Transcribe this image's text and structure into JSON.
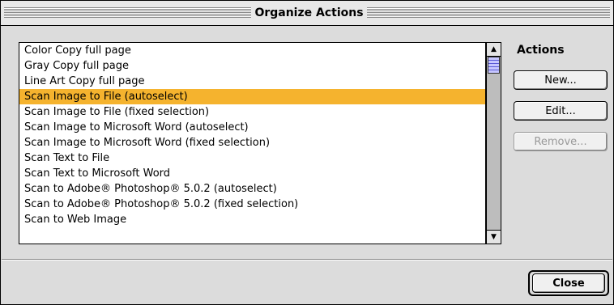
{
  "window": {
    "title": "Organize Actions"
  },
  "list": {
    "items": [
      "Color Copy full page",
      "Gray Copy full page",
      "Line Art Copy full page",
      "Scan Image to File (autoselect)",
      "Scan Image to File (fixed selection)",
      "Scan Image to Microsoft Word (autoselect)",
      "Scan Image to Microsoft Word (fixed selection)",
      "Scan Text to File",
      "Scan Text to Microsoft Word",
      "Scan to Adobe® Photoshop® 5.0.2 (autoselect)",
      "Scan to Adobe® Photoshop® 5.0.2 (fixed selection)",
      "Scan to Web Image"
    ],
    "selected_index": 3,
    "highlight_color": "#f5b32e"
  },
  "scrollbar": {
    "up_icon": "triangle-up-icon",
    "down_icon": "triangle-down-icon"
  },
  "actions": {
    "label": "Actions",
    "new_label": "New...",
    "edit_label": "Edit...",
    "remove_label": "Remove..."
  },
  "footer": {
    "close_label": "Close"
  }
}
